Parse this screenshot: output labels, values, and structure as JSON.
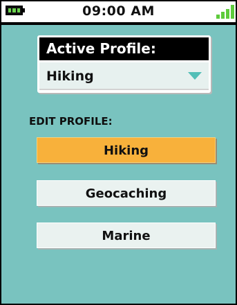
{
  "status_bar": {
    "time": "09:00 AM",
    "battery_icon": "battery-full-icon",
    "signal_icon": "signal-strength-icon"
  },
  "active_profile": {
    "header": "Active Profile:",
    "selected": "Hiking",
    "dropdown_icon": "chevron-down-icon"
  },
  "edit_profile": {
    "label": "EDIT PROFILE:",
    "buttons": [
      {
        "label": "Hiking",
        "state": "selected"
      },
      {
        "label": "Geocaching",
        "state": "default"
      },
      {
        "label": "Marine",
        "state": "default"
      }
    ]
  },
  "colors": {
    "background": "#79c3bf",
    "active_button": "#f8b13b",
    "button_bg": "#eaf2f0",
    "battery": "#6bd44e",
    "signal": "#5ecb3c",
    "dropdown_arrow": "#52bfb7"
  }
}
